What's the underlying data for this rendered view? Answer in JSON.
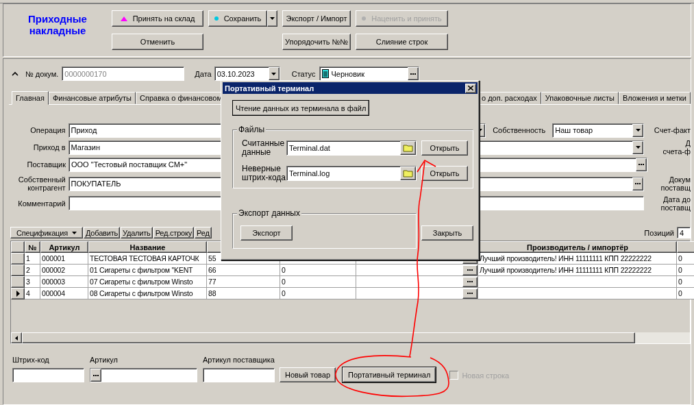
{
  "header": {
    "title": "Приходные накладные",
    "buttons": [
      {
        "label": "Принять на склад",
        "kind": "plain",
        "disabled": false
      },
      {
        "label": "Сохранить",
        "kind": "split",
        "disabled": false
      },
      {
        "label": "Экспорт / Импорт",
        "kind": "plain",
        "disabled": false
      },
      {
        "label": "Наценить и принять",
        "kind": "plain",
        "disabled": true
      },
      {
        "label": "Отменить",
        "kind": "plain",
        "disabled": false
      },
      {
        "label": "Упорядочить №№",
        "kind": "plain",
        "disabled": false
      },
      {
        "label": "Слияние строк",
        "kind": "plain",
        "disabled": false
      }
    ]
  },
  "document": {
    "number_label": "№ докум.",
    "number": "0000000170",
    "date_label": "Дата",
    "date": "03.10.2023",
    "status_label": "Статус",
    "status": "Черновик"
  },
  "tabs": [
    {
      "label": "Главная",
      "selected": true
    },
    {
      "label": "Финансовые атрибуты",
      "selected": false
    },
    {
      "label": "Справка о финансовом",
      "selected": false
    },
    {
      "label": "о доп. расходах",
      "selected": false
    },
    {
      "label": "Упаковочные листы",
      "selected": false
    },
    {
      "label": "Вложения и метки",
      "selected": false
    }
  ],
  "form": [
    {
      "label": "Операция",
      "value": "Приход",
      "kind": "combo",
      "side_label": "Счет-факт"
    },
    {
      "label": "Приход в",
      "value": "Магазин",
      "kind": "combo",
      "side_label": "Д\nсчета-ф"
    },
    {
      "label": "Поставщик",
      "value": "ООО \"Тестовый поставщик СМ+\"",
      "kind": "lookup"
    },
    {
      "label": "Собственный\nконтрагент",
      "value": "ПОКУПАТЕЛЬ",
      "kind": "lookup",
      "side_label": "Докум\nпоставщ"
    },
    {
      "label": "Комментарий",
      "kind": "text",
      "side_label": "Дата до\nпоставщ"
    }
  ],
  "ownership": {
    "label": "Собственность",
    "value": "Наш товар"
  },
  "spec_toolbar": {
    "buttons": [
      {
        "label": "Спецификация",
        "kind": "menu"
      },
      {
        "label": "Добавить",
        "kind": "plain"
      },
      {
        "label": "Удалить",
        "kind": "plain"
      },
      {
        "label": "Ред.строку",
        "kind": "plain"
      },
      {
        "label": "Ред",
        "kind": "plain"
      }
    ],
    "positions_label": "Позиций",
    "positions": "4"
  },
  "table": {
    "columns": {
      "number": "№",
      "article": "Артикул",
      "name": "Название",
      "producer": "Производитель / импортёр"
    },
    "rows": [
      {
        "selected": false,
        "number": "1",
        "article": "000001",
        "name": "ТЕСТОВАЯ ТЕСТОВАЯ КАРТОЧК",
        "column_5": "55",
        "producer": "Лучший производитель! ИНН 11111111  КПП 22222222",
        "column_9": "0"
      },
      {
        "selected": false,
        "number": "2",
        "article": "000002",
        "name": "01 Сигареты с фильтром  \"KENT",
        "column_5": "66",
        "column_6": "0",
        "producer": "Лучший производитель! ИНН 11111111  КПП 22222222",
        "column_9": "0"
      },
      {
        "selected": false,
        "number": "3",
        "article": "000003",
        "name": "07 Сигареты с фильтром  Winsto",
        "column_5": "77",
        "column_6": "0",
        "column_9": "0"
      },
      {
        "selected": true,
        "number": "4",
        "article": "000004",
        "name": "08 Сигареты с фильтром  Winsto",
        "column_5": "88",
        "column_6": "0",
        "column_9": "0"
      }
    ]
  },
  "entry": {
    "fields": [
      {
        "label": "Штрих-код",
        "kind": "text"
      },
      {
        "label": "Артикул",
        "kind": "lookup"
      },
      {
        "label": "Артикул поставщика",
        "kind": "text"
      }
    ],
    "buttons": [
      {
        "label": "Новый товар",
        "focused": false
      },
      {
        "label": "Портативный терминал",
        "focused": true
      }
    ],
    "new_row": {
      "label": "Новая строка",
      "checked": false,
      "disabled": true
    }
  },
  "dialog": {
    "title": "Портативный терминал",
    "read_button": "Чтение данных из терминала в файл",
    "files_title": "Файлы",
    "files": [
      {
        "label": "Считанные\nданные",
        "value": "Terminal.dat",
        "button": "Открыть"
      },
      {
        "label": "Неверные\nштрих-кода",
        "value": "Terminal.log",
        "button": "Открыть"
      }
    ],
    "export_title": "Экспорт данных",
    "export_button": "Экспорт",
    "close_button": "Закрыть"
  }
}
